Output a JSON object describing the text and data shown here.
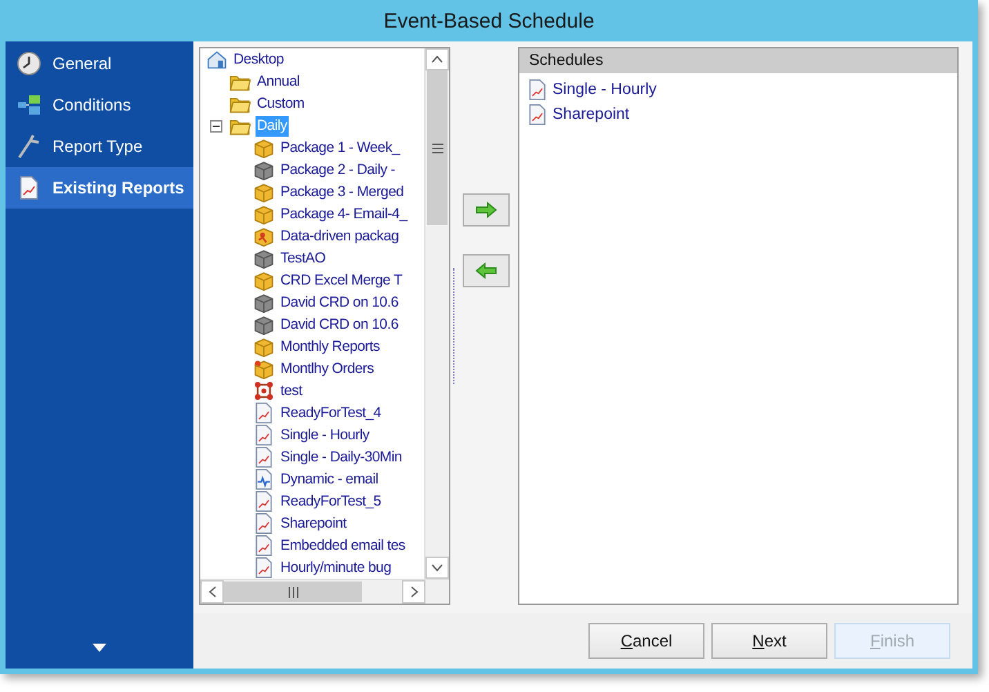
{
  "window": {
    "title": "Event-Based Schedule"
  },
  "sidebar": {
    "items": [
      {
        "label": "General",
        "kind": "clock",
        "selected": false
      },
      {
        "label": "Conditions",
        "kind": "blocks",
        "selected": false
      },
      {
        "label": "Report Type",
        "kind": "compass",
        "selected": false
      },
      {
        "label": "Existing Reports",
        "kind": "report",
        "selected": true
      }
    ]
  },
  "tree": {
    "items": [
      {
        "label": "Desktop",
        "kind": "home",
        "selected": false,
        "children": [
          {
            "label": "Annual",
            "kind": "folder",
            "selected": false
          },
          {
            "label": "Custom",
            "kind": "folder",
            "selected": false
          },
          {
            "label": "Daily",
            "kind": "folder",
            "selected": true,
            "expanded": true,
            "children": [
              {
                "label": "Package 1 - Week_",
                "kind": "package",
                "selected": false
              },
              {
                "label": "Package 2 - Daily -",
                "kind": "package-grey",
                "selected": false
              },
              {
                "label": "Package 3 - Merged",
                "kind": "package",
                "selected": false
              },
              {
                "label": "Package 4- Email-4_",
                "kind": "package",
                "selected": false
              },
              {
                "label": "Data-driven packag",
                "kind": "package-data",
                "selected": false
              },
              {
                "label": "TestAO",
                "kind": "package-grey",
                "selected": false
              },
              {
                "label": "CRD Excel Merge T",
                "kind": "package",
                "selected": false
              },
              {
                "label": "David CRD on 10.6",
                "kind": "package-grey",
                "selected": false
              },
              {
                "label": "David CRD on 10.6",
                "kind": "package-grey",
                "selected": false
              },
              {
                "label": "Monthly Reports",
                "kind": "package",
                "selected": false
              },
              {
                "label": "Montlhy Orders",
                "kind": "package-dynamic",
                "selected": false
              },
              {
                "label": "test",
                "kind": "cluster",
                "selected": false
              },
              {
                "label": "ReadyForTest_4",
                "kind": "report",
                "selected": false
              },
              {
                "label": "Single - Hourly",
                "kind": "report",
                "selected": false
              },
              {
                "label": "Single - Daily-30Min",
                "kind": "report",
                "selected": false
              },
              {
                "label": "Dynamic - email",
                "kind": "report-dynamic",
                "selected": false
              },
              {
                "label": "ReadyForTest_5",
                "kind": "report",
                "selected": false
              },
              {
                "label": "Sharepoint",
                "kind": "report",
                "selected": false
              },
              {
                "label": "Embedded email tes",
                "kind": "report",
                "selected": false
              },
              {
                "label": "Hourly/minute bug",
                "kind": "report",
                "selected": false
              }
            ]
          }
        ]
      }
    ]
  },
  "schedules": {
    "header": "Schedules",
    "items": [
      {
        "label": "Single - Hourly",
        "kind": "report"
      },
      {
        "label": "Sharepoint",
        "kind": "report"
      }
    ]
  },
  "buttons": [
    {
      "key": "C",
      "rest": "ancel",
      "disabled": false
    },
    {
      "key": "N",
      "rest": "ext",
      "disabled": false
    },
    {
      "key": "F",
      "rest": "inish",
      "disabled": true
    }
  ]
}
